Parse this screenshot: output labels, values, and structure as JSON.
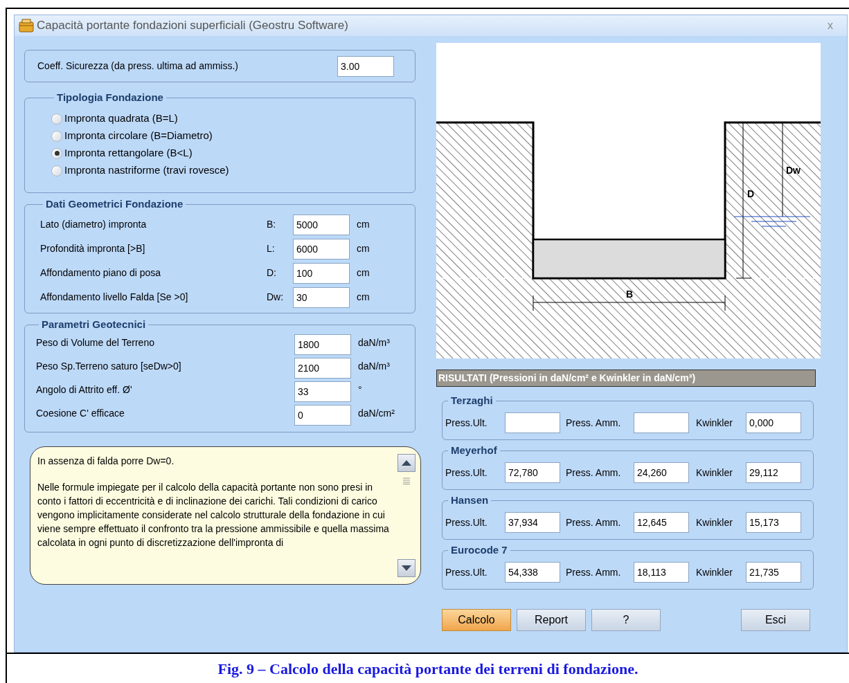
{
  "window": {
    "title": "Capacità portante fondazioni superficiali (Geostru Software)",
    "close": "x"
  },
  "safety_factor": {
    "label": "Coeff. Sicurezza  (da press. ultima ad ammiss.)",
    "value": "3.00"
  },
  "foundation_type": {
    "title": "Tipologia  Fondazione",
    "options": [
      {
        "label": "Impronta quadrata (B=L)",
        "selected": false
      },
      {
        "label": "Impronta  circolare (B=Diametro)",
        "selected": false
      },
      {
        "label": "Impronta rettangolare (B<L)",
        "selected": true
      },
      {
        "label": "Impronta nastriforme (travi  rovesce)",
        "selected": false
      }
    ]
  },
  "geometry": {
    "title": "Dati Geometrici  Fondazione",
    "rows": [
      {
        "label": "Lato (diametro) impronta",
        "symbol": "B:",
        "value": "5000",
        "unit": "cm"
      },
      {
        "label": "Profondità impronta [>B]",
        "symbol": "L:",
        "value": "6000",
        "unit": "cm"
      },
      {
        "label": "Affondamento piano di posa",
        "symbol": "D:",
        "value": "100",
        "unit": "cm"
      },
      {
        "label": "Affondamento livello Falda [Se >0]",
        "symbol": "Dw:",
        "value": "30",
        "unit": "cm"
      }
    ]
  },
  "geotechnical": {
    "title": "Parametri  Geotecnici",
    "rows": [
      {
        "label": "Peso di Volume del Terreno",
        "value": "1800",
        "unit": "daN/m³"
      },
      {
        "label": "Peso Sp.Terreno saturo [seDw>0]",
        "value": "2100",
        "unit": "daN/m³"
      },
      {
        "label": "Angolo di Attrito eff.  Ø'",
        "value": "33",
        "unit": "°"
      },
      {
        "label": "Coesione  C' efficace",
        "value": "0",
        "unit": "daN/cm²"
      }
    ]
  },
  "notes": {
    "paragraphs": [
      "In assenza di falda porre Dw=0.",
      "Nelle formule impiegate per il calcolo della capacità portante non sono presi in conto i fattori di eccentricità e di inclinazione dei carichi. Tali condizioni di carico vengono implicitamente considerate nel calcolo strutturale della fondazione in cui viene sempre effettuato il confronto tra la pressione ammissibile e quella massima calcolata in ogni punto di discretizzazione dell'impronta di"
    ]
  },
  "diagram": {
    "width_label": "B",
    "depth_label": "D",
    "water_label": "Dw"
  },
  "results": {
    "header": "RISULTATI (Pressioni in daN/cm² e Kwinkler in daN/cm³)",
    "methods": [
      {
        "name": "Terzaghi",
        "fields": [
          {
            "label": "Press.Ult."
          },
          {
            "label": "Press. Amm."
          },
          {
            "label": "Kwinkler",
            "value": "0,000"
          }
        ]
      },
      {
        "name": "Meyerhof",
        "fields": [
          {
            "label": "Press.Ult.",
            "value": "72,780"
          },
          {
            "label": "Press. Amm.",
            "value": "24,260"
          },
          {
            "label": "Kwinkler",
            "value": "29,112"
          }
        ]
      },
      {
        "name": "Hansen",
        "fields": [
          {
            "label": "Press.Ult.",
            "value": "37,934"
          },
          {
            "label": "Press. Amm.",
            "value": "12,645"
          },
          {
            "label": "Kwinkler",
            "value": "15,173"
          }
        ]
      },
      {
        "name": "Eurocode 7",
        "fields": [
          {
            "label": "Press.Ult.",
            "value": "54,338"
          },
          {
            "label": "Press. Amm.",
            "value": "18,113"
          },
          {
            "label": "Kwinkler",
            "value": "21,735"
          }
        ]
      }
    ]
  },
  "buttons": [
    {
      "label": "Calcolo",
      "selected": true
    },
    {
      "label": "Report",
      "selected": false
    },
    {
      "label": "?",
      "selected": false
    },
    {
      "label": "Esci",
      "selected": false
    }
  ],
  "caption": "Fig. 9 – Calcolo della capacità portante dei terreni di fondazione."
}
